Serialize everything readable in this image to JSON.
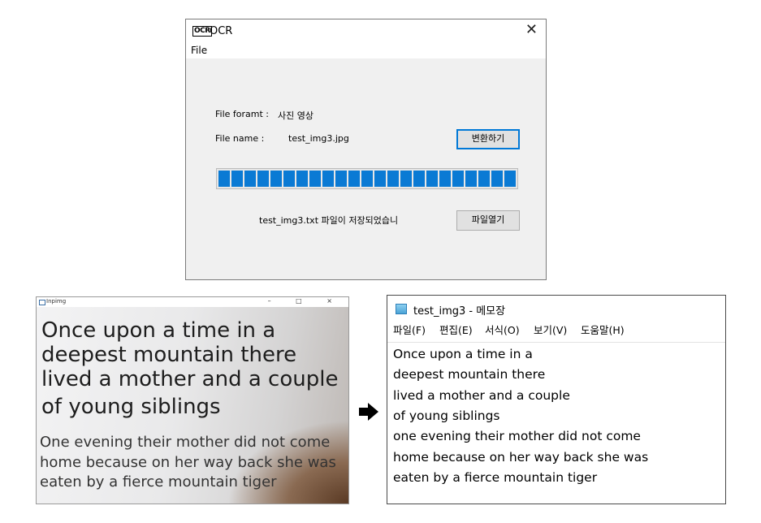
{
  "ocr_window": {
    "title": "OCR",
    "close_glyph": "✕",
    "icon_text": "OCR",
    "menu": {
      "file": "File"
    },
    "format_label": "File foramt :",
    "format_value": "사진 영상",
    "name_label": "File name :",
    "name_value": "test_img3.jpg",
    "convert_button": "변환하기",
    "progress_percent": 100,
    "saved_message": "test_img3.txt 파일이 저장되었습니",
    "open_button": "파일열기"
  },
  "image_window": {
    "title": "Inpimg",
    "controls": "– □ ×",
    "big_text": [
      "Once upon a time in a",
      "deepest mountain there",
      "lived a mother and a couple",
      "of young siblings"
    ],
    "small_text": [
      "One evening their mother did not come",
      "home because on her way back she was",
      "eaten by a fierce mountain tiger"
    ]
  },
  "notepad_window": {
    "title": "test_img3 - 메모장",
    "menu": [
      "파일(F)",
      "편집(E)",
      "서식(O)",
      "보기(V)",
      "도움말(H)"
    ],
    "lines": [
      "Once upon a time in a",
      "deepest mountain there",
      "lived a mother and a couple",
      "of young siblings",
      "one evening their mother did not come",
      "home because on her way back she was",
      "eaten by a fierce mountain tiger"
    ]
  },
  "colors": {
    "progress_fill": "#0a7ad4",
    "window_bg": "#f0f0f0"
  }
}
